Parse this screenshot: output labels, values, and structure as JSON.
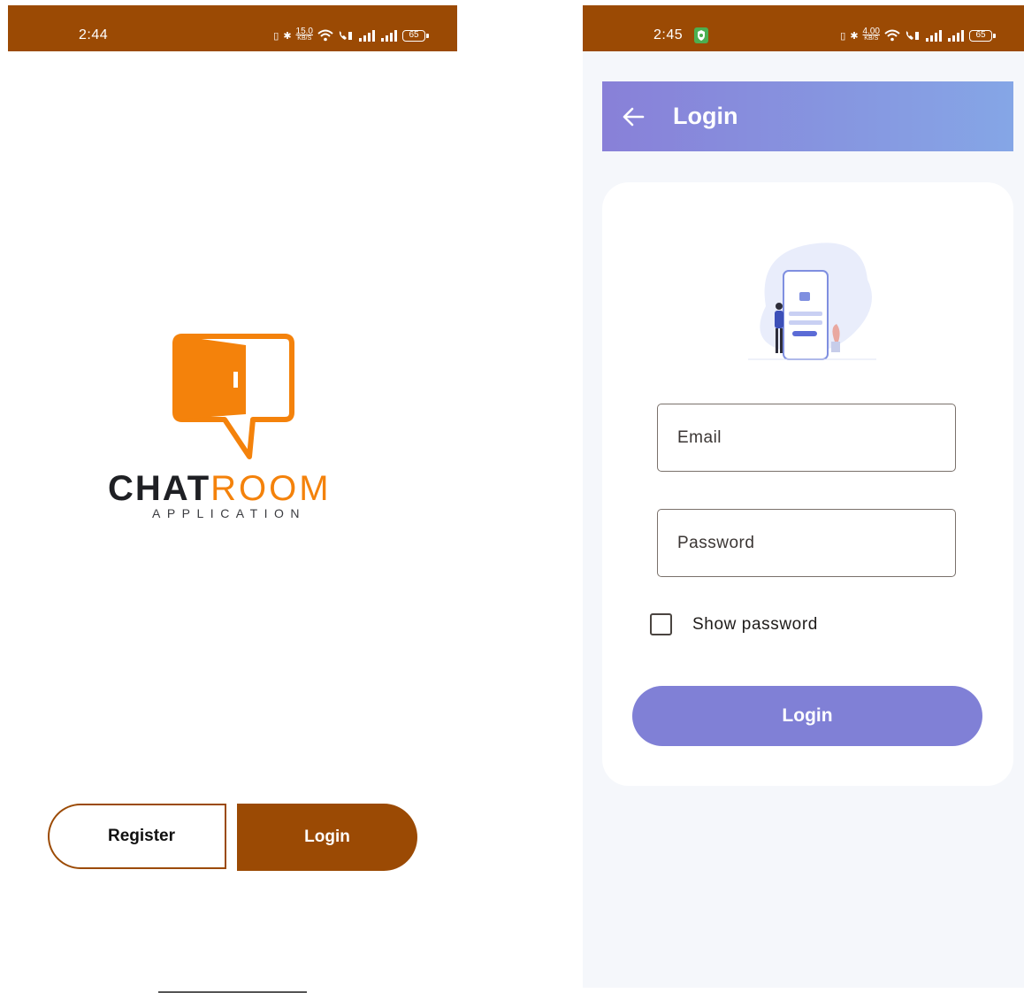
{
  "colors": {
    "status_bar": "#9b4a04",
    "logo_orange": "#f4820b",
    "logo_dark": "#1f2024",
    "login_accent": "#8080d6",
    "app_bar_start": "#8880d8",
    "app_bar_end": "#85a6e6"
  },
  "left_screen": {
    "status": {
      "time": "2:44",
      "speed_value": "15.0",
      "speed_unit": "KB/S",
      "battery": "65"
    },
    "logo": {
      "word_dark": "CHAT",
      "word_orange": "ROOM",
      "subtitle": "APPLICATION",
      "icon": "chat-bubble-door-icon"
    },
    "buttons": {
      "register": "Register",
      "login": "Login"
    }
  },
  "right_screen": {
    "status": {
      "time": "2:45",
      "speed_value": "4.00",
      "speed_unit": "KB/S",
      "battery": "65"
    },
    "app_bar": {
      "back_icon": "arrow-left-icon",
      "title": "Login"
    },
    "form": {
      "email_placeholder": "Email",
      "password_placeholder": "Password",
      "show_password_label": "Show password",
      "show_password_checked": false,
      "submit_label": "Login"
    }
  }
}
